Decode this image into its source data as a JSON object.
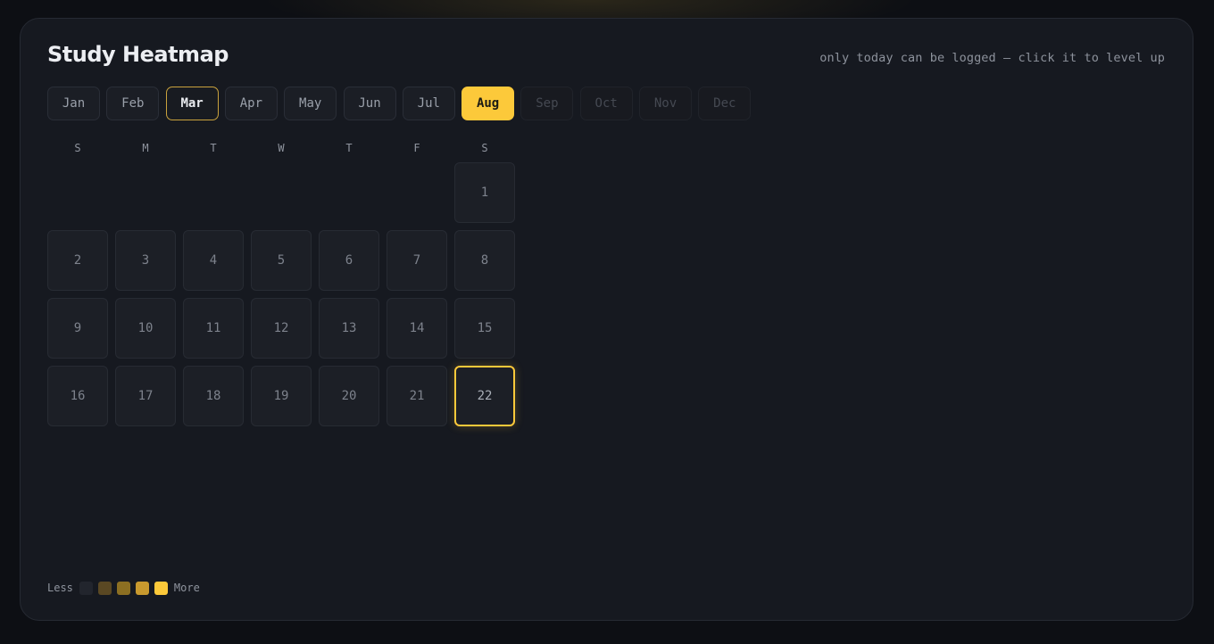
{
  "header": {
    "title": "Study Heatmap",
    "hint": "only today can be logged — click it to level up"
  },
  "months": [
    {
      "label": "Jan",
      "state": "normal"
    },
    {
      "label": "Feb",
      "state": "normal"
    },
    {
      "label": "Mar",
      "state": "selected"
    },
    {
      "label": "Apr",
      "state": "normal"
    },
    {
      "label": "May",
      "state": "normal"
    },
    {
      "label": "Jun",
      "state": "normal"
    },
    {
      "label": "Jul",
      "state": "normal"
    },
    {
      "label": "Aug",
      "state": "current"
    },
    {
      "label": "Sep",
      "state": "disabled"
    },
    {
      "label": "Oct",
      "state": "disabled"
    },
    {
      "label": "Nov",
      "state": "disabled"
    },
    {
      "label": "Dec",
      "state": "disabled"
    }
  ],
  "weekdays": [
    "S",
    "M",
    "T",
    "W",
    "T",
    "F",
    "S"
  ],
  "calendar": {
    "first_weekday_index": 6,
    "days": [
      "1",
      "2",
      "3",
      "4",
      "5",
      "6",
      "7",
      "8",
      "9",
      "10",
      "11",
      "12",
      "13",
      "14",
      "15",
      "16",
      "17",
      "18",
      "19",
      "20",
      "21",
      "22"
    ],
    "today": "22"
  },
  "legend": {
    "less": "Less",
    "more": "More",
    "levels": [
      "#22252d",
      "#5a4823",
      "#8c6f22",
      "#c8992e",
      "#fcc93a"
    ]
  },
  "colors": {
    "accent": "#fcc93a",
    "card_bg": "#161920",
    "cell_bg": "#1c1f26"
  }
}
